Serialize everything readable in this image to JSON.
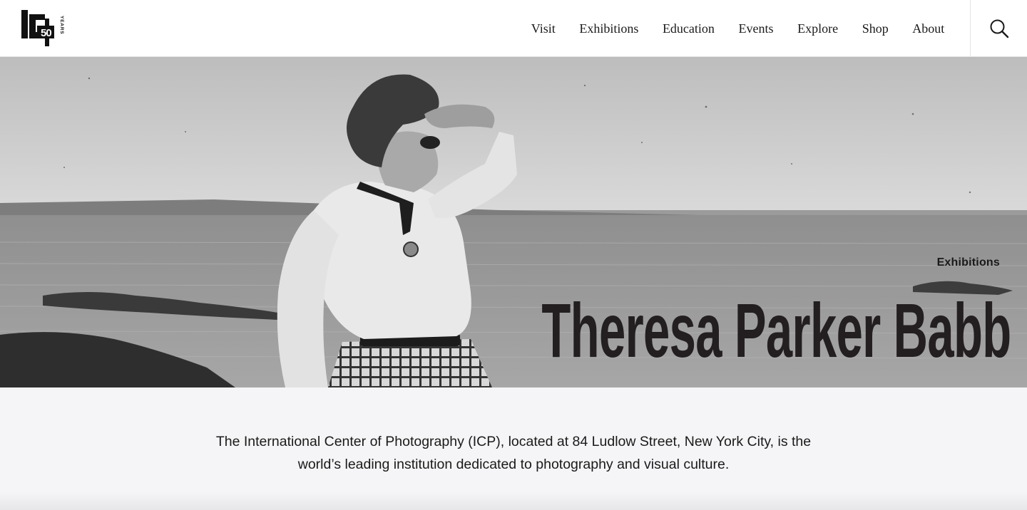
{
  "logo": {
    "mark": "ICP",
    "number": "50",
    "word": "YEARS",
    "icon": "icp-50-years-logo"
  },
  "nav": {
    "items": [
      {
        "label": "Visit"
      },
      {
        "label": "Exhibitions"
      },
      {
        "label": "Education"
      },
      {
        "label": "Events"
      },
      {
        "label": "Explore"
      },
      {
        "label": "Shop"
      },
      {
        "label": "About"
      }
    ],
    "search_icon": "search-icon"
  },
  "hero": {
    "tag": "Exhibitions",
    "title": "Theresa Parker Babb",
    "image_icon": "black-and-white-photograph"
  },
  "intro": {
    "text": "The International Center of Photography (ICP), located at 84 Ludlow Street, New York City, is the world’s leading institution dedicated to photography and visual culture."
  },
  "colors": {
    "header_bg": "#ffffff",
    "page_bg": "#f5f5f7",
    "text": "#1a1a1a",
    "title": "#231f20"
  }
}
